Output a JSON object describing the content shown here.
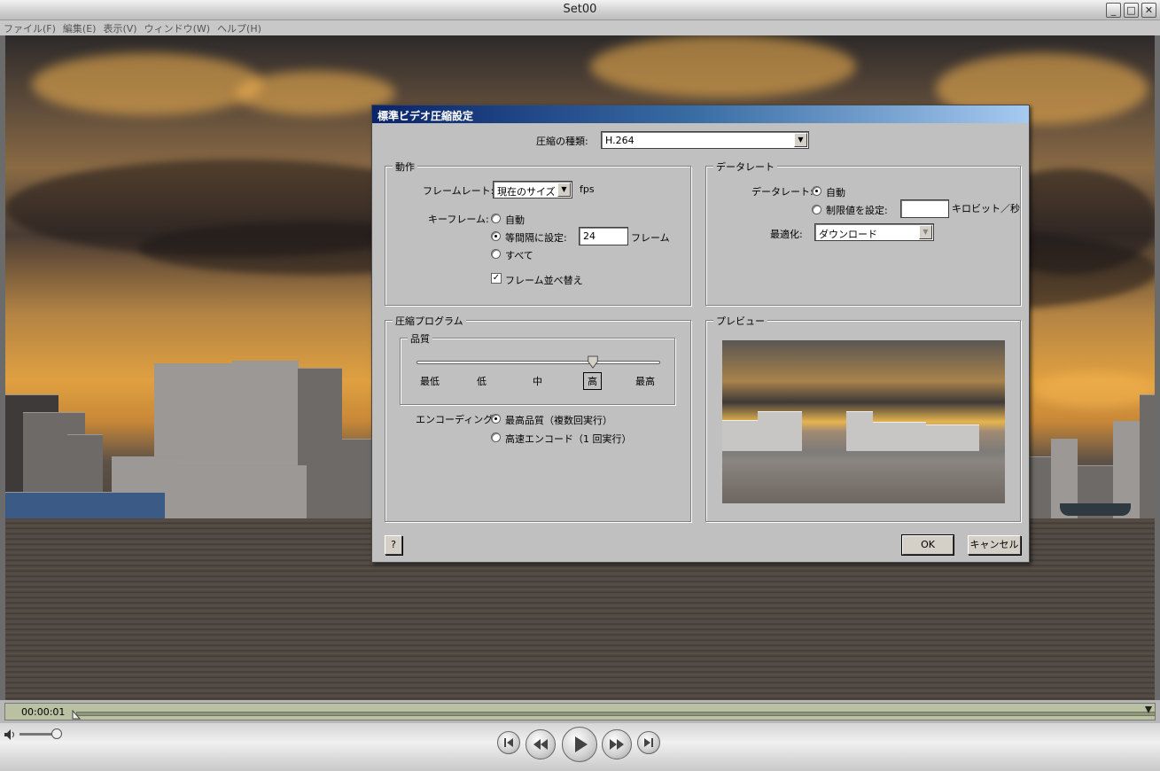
{
  "window": {
    "title": "Set00",
    "minimize_glyph": "_",
    "maximize_glyph": "□",
    "close_glyph": "✕"
  },
  "menu": [
    "ファイル(F)",
    "編集(E)",
    "表示(V)",
    "ウィンドウ(W)",
    "ヘルプ(H)"
  ],
  "dialog": {
    "title": "標準ビデオ圧縮設定",
    "compression_type_label": "圧縮の種類:",
    "compression_type_value": "H.264",
    "motion": {
      "title": "動作",
      "frame_rate_label": "フレームレート:",
      "frame_rate_value": "現在のサイズ",
      "fps_label": "fps",
      "keyframe_label": "キーフレーム:",
      "keyframe_options": [
        "自動",
        "等間隔に設定:",
        "すべて"
      ],
      "keyframe_selected": 1,
      "keyframe_interval": "24",
      "frames_label": "フレーム",
      "reorder_label": "フレーム並べ替え",
      "reorder_checked": true
    },
    "data_rate": {
      "title": "データレート",
      "label": "データレート:",
      "options": [
        "自動",
        "制限値を設定:"
      ],
      "selected": 0,
      "limit_value": "",
      "unit_label": "キロビット／秒",
      "optimize_label": "最適化:",
      "optimize_value": "ダウンロード"
    },
    "compressor": {
      "title": "圧縮プログラム",
      "quality_title": "品質",
      "quality_ticks": [
        "最低",
        "低",
        "中",
        "高",
        "最高"
      ],
      "quality_selected": "高",
      "encoding_label": "エンコーディング:",
      "encoding_options": [
        "最高品質（複数回実行）",
        "高速エンコード（1 回実行）"
      ],
      "encoding_selected": 0
    },
    "preview": {
      "title": "プレビュー"
    },
    "help_label": "?",
    "ok_label": "OK",
    "cancel_label": "キャンセル"
  },
  "player": {
    "timecode": "00:00:01",
    "icons": [
      "volume-icon",
      "go-to-start-icon",
      "rewind-icon",
      "play-icon",
      "fast-forward-icon",
      "go-to-end-icon"
    ]
  }
}
